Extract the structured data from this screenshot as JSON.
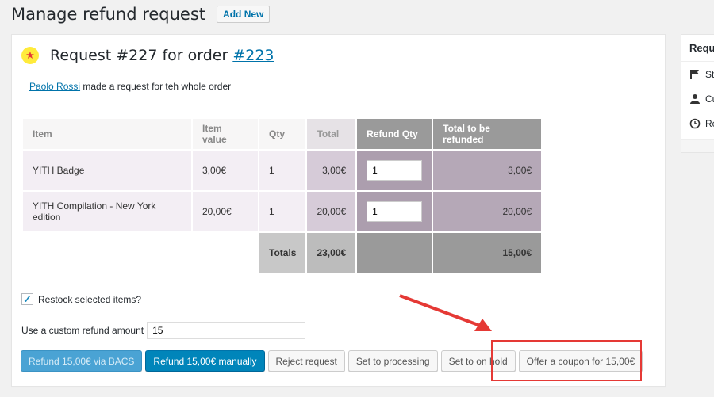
{
  "header": {
    "title": "Manage refund request",
    "add_new_label": "Add New"
  },
  "request": {
    "title_prefix": "Request #227 for order ",
    "order_link": "#223",
    "customer_name": "Paolo Rossi",
    "description_suffix": " made a request for teh whole order"
  },
  "table": {
    "headers": [
      "Item",
      "Item value",
      "Qty",
      "Total",
      "Refund Qty",
      "Total to be refunded"
    ],
    "rows": [
      {
        "item": "YITH Badge",
        "value": "3,00€",
        "qty": "1",
        "total": "3,00€",
        "refund_qty": "1",
        "refund_total": "3,00€"
      },
      {
        "item": "YITH Compilation - New York edition",
        "value": "20,00€",
        "qty": "1",
        "total": "20,00€",
        "refund_qty": "1",
        "refund_total": "20,00€"
      }
    ],
    "footer": {
      "label": "Totals",
      "total": "23,00€",
      "refund_total": "15,00€"
    }
  },
  "restock": {
    "label": "Restock selected items?",
    "checked": true
  },
  "custom_amount": {
    "label": "Use a custom refund amount",
    "value": "15"
  },
  "buttons": {
    "refund_bacs": "Refund 15,00€ via BACS",
    "refund_manual": "Refund 15,00€ manually",
    "reject": "Reject request",
    "processing": "Set to processing",
    "on_hold": "Set to on hold",
    "coupon": "Offer a coupon for 15,00€"
  },
  "sidebar": {
    "title": "Requ",
    "rows": [
      {
        "icon": "flag-icon",
        "label": "St"
      },
      {
        "icon": "user-icon",
        "label": "Cu"
      },
      {
        "icon": "clock-icon",
        "label": "Re"
      }
    ]
  },
  "colors": {
    "accent": "#0085ba",
    "link": "#0073aa",
    "highlight": "#e53935"
  }
}
